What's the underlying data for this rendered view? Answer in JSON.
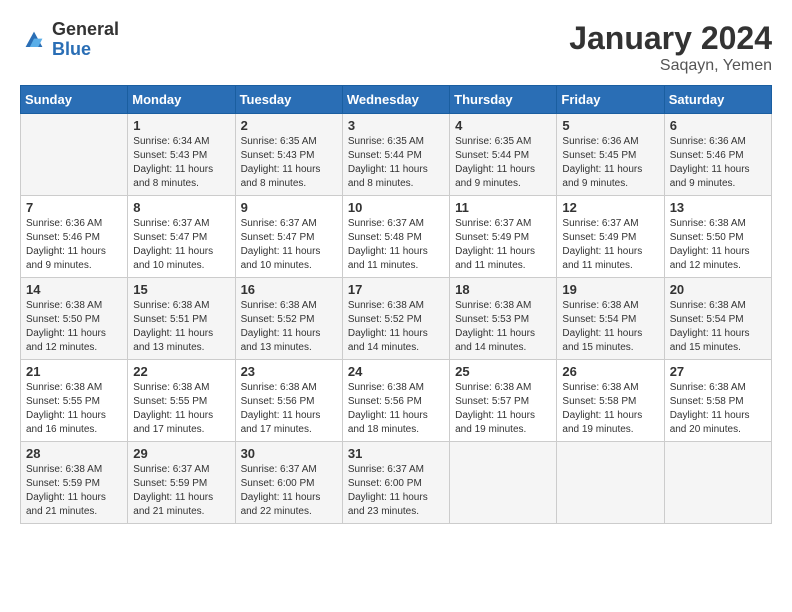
{
  "header": {
    "logo_general": "General",
    "logo_blue": "Blue",
    "month_title": "January 2024",
    "location": "Saqayn, Yemen"
  },
  "weekdays": [
    "Sunday",
    "Monday",
    "Tuesday",
    "Wednesday",
    "Thursday",
    "Friday",
    "Saturday"
  ],
  "weeks": [
    [
      {
        "day": "",
        "sunrise": "",
        "sunset": "",
        "daylight": ""
      },
      {
        "day": "1",
        "sunrise": "Sunrise: 6:34 AM",
        "sunset": "Sunset: 5:43 PM",
        "daylight": "Daylight: 11 hours and 8 minutes."
      },
      {
        "day": "2",
        "sunrise": "Sunrise: 6:35 AM",
        "sunset": "Sunset: 5:43 PM",
        "daylight": "Daylight: 11 hours and 8 minutes."
      },
      {
        "day": "3",
        "sunrise": "Sunrise: 6:35 AM",
        "sunset": "Sunset: 5:44 PM",
        "daylight": "Daylight: 11 hours and 8 minutes."
      },
      {
        "day": "4",
        "sunrise": "Sunrise: 6:35 AM",
        "sunset": "Sunset: 5:44 PM",
        "daylight": "Daylight: 11 hours and 9 minutes."
      },
      {
        "day": "5",
        "sunrise": "Sunrise: 6:36 AM",
        "sunset": "Sunset: 5:45 PM",
        "daylight": "Daylight: 11 hours and 9 minutes."
      },
      {
        "day": "6",
        "sunrise": "Sunrise: 6:36 AM",
        "sunset": "Sunset: 5:46 PM",
        "daylight": "Daylight: 11 hours and 9 minutes."
      }
    ],
    [
      {
        "day": "7",
        "sunrise": "Sunrise: 6:36 AM",
        "sunset": "Sunset: 5:46 PM",
        "daylight": "Daylight: 11 hours and 9 minutes."
      },
      {
        "day": "8",
        "sunrise": "Sunrise: 6:37 AM",
        "sunset": "Sunset: 5:47 PM",
        "daylight": "Daylight: 11 hours and 10 minutes."
      },
      {
        "day": "9",
        "sunrise": "Sunrise: 6:37 AM",
        "sunset": "Sunset: 5:47 PM",
        "daylight": "Daylight: 11 hours and 10 minutes."
      },
      {
        "day": "10",
        "sunrise": "Sunrise: 6:37 AM",
        "sunset": "Sunset: 5:48 PM",
        "daylight": "Daylight: 11 hours and 11 minutes."
      },
      {
        "day": "11",
        "sunrise": "Sunrise: 6:37 AM",
        "sunset": "Sunset: 5:49 PM",
        "daylight": "Daylight: 11 hours and 11 minutes."
      },
      {
        "day": "12",
        "sunrise": "Sunrise: 6:37 AM",
        "sunset": "Sunset: 5:49 PM",
        "daylight": "Daylight: 11 hours and 11 minutes."
      },
      {
        "day": "13",
        "sunrise": "Sunrise: 6:38 AM",
        "sunset": "Sunset: 5:50 PM",
        "daylight": "Daylight: 11 hours and 12 minutes."
      }
    ],
    [
      {
        "day": "14",
        "sunrise": "Sunrise: 6:38 AM",
        "sunset": "Sunset: 5:50 PM",
        "daylight": "Daylight: 11 hours and 12 minutes."
      },
      {
        "day": "15",
        "sunrise": "Sunrise: 6:38 AM",
        "sunset": "Sunset: 5:51 PM",
        "daylight": "Daylight: 11 hours and 13 minutes."
      },
      {
        "day": "16",
        "sunrise": "Sunrise: 6:38 AM",
        "sunset": "Sunset: 5:52 PM",
        "daylight": "Daylight: 11 hours and 13 minutes."
      },
      {
        "day": "17",
        "sunrise": "Sunrise: 6:38 AM",
        "sunset": "Sunset: 5:52 PM",
        "daylight": "Daylight: 11 hours and 14 minutes."
      },
      {
        "day": "18",
        "sunrise": "Sunrise: 6:38 AM",
        "sunset": "Sunset: 5:53 PM",
        "daylight": "Daylight: 11 hours and 14 minutes."
      },
      {
        "day": "19",
        "sunrise": "Sunrise: 6:38 AM",
        "sunset": "Sunset: 5:54 PM",
        "daylight": "Daylight: 11 hours and 15 minutes."
      },
      {
        "day": "20",
        "sunrise": "Sunrise: 6:38 AM",
        "sunset": "Sunset: 5:54 PM",
        "daylight": "Daylight: 11 hours and 15 minutes."
      }
    ],
    [
      {
        "day": "21",
        "sunrise": "Sunrise: 6:38 AM",
        "sunset": "Sunset: 5:55 PM",
        "daylight": "Daylight: 11 hours and 16 minutes."
      },
      {
        "day": "22",
        "sunrise": "Sunrise: 6:38 AM",
        "sunset": "Sunset: 5:55 PM",
        "daylight": "Daylight: 11 hours and 17 minutes."
      },
      {
        "day": "23",
        "sunrise": "Sunrise: 6:38 AM",
        "sunset": "Sunset: 5:56 PM",
        "daylight": "Daylight: 11 hours and 17 minutes."
      },
      {
        "day": "24",
        "sunrise": "Sunrise: 6:38 AM",
        "sunset": "Sunset: 5:56 PM",
        "daylight": "Daylight: 11 hours and 18 minutes."
      },
      {
        "day": "25",
        "sunrise": "Sunrise: 6:38 AM",
        "sunset": "Sunset: 5:57 PM",
        "daylight": "Daylight: 11 hours and 19 minutes."
      },
      {
        "day": "26",
        "sunrise": "Sunrise: 6:38 AM",
        "sunset": "Sunset: 5:58 PM",
        "daylight": "Daylight: 11 hours and 19 minutes."
      },
      {
        "day": "27",
        "sunrise": "Sunrise: 6:38 AM",
        "sunset": "Sunset: 5:58 PM",
        "daylight": "Daylight: 11 hours and 20 minutes."
      }
    ],
    [
      {
        "day": "28",
        "sunrise": "Sunrise: 6:38 AM",
        "sunset": "Sunset: 5:59 PM",
        "daylight": "Daylight: 11 hours and 21 minutes."
      },
      {
        "day": "29",
        "sunrise": "Sunrise: 6:37 AM",
        "sunset": "Sunset: 5:59 PM",
        "daylight": "Daylight: 11 hours and 21 minutes."
      },
      {
        "day": "30",
        "sunrise": "Sunrise: 6:37 AM",
        "sunset": "Sunset: 6:00 PM",
        "daylight": "Daylight: 11 hours and 22 minutes."
      },
      {
        "day": "31",
        "sunrise": "Sunrise: 6:37 AM",
        "sunset": "Sunset: 6:00 PM",
        "daylight": "Daylight: 11 hours and 23 minutes."
      },
      {
        "day": "",
        "sunrise": "",
        "sunset": "",
        "daylight": ""
      },
      {
        "day": "",
        "sunrise": "",
        "sunset": "",
        "daylight": ""
      },
      {
        "day": "",
        "sunrise": "",
        "sunset": "",
        "daylight": ""
      }
    ]
  ]
}
